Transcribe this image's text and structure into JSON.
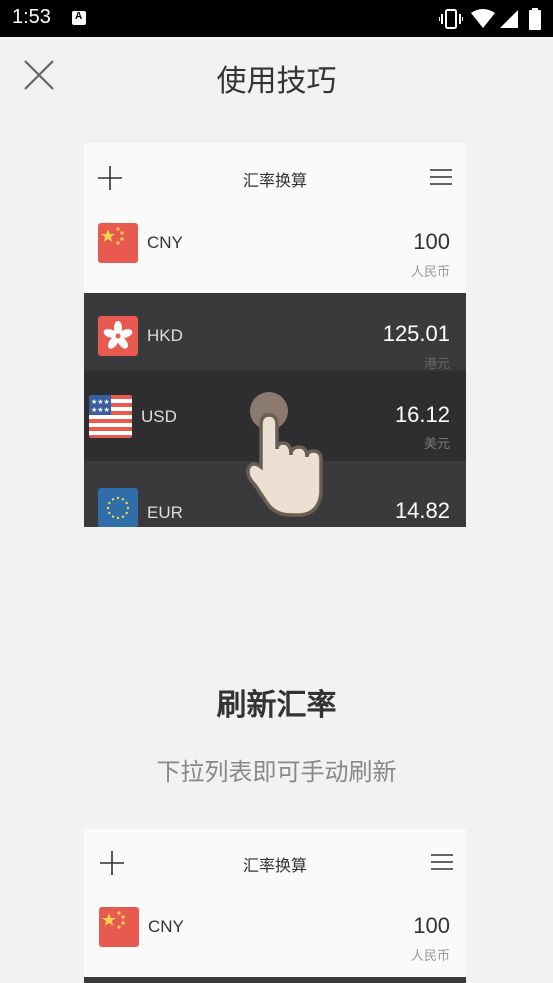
{
  "status_bar": {
    "time": "1:53"
  },
  "page": {
    "title": "使用技巧"
  },
  "demo1": {
    "header_title": "汇率换算",
    "rows": [
      {
        "code": "CNY",
        "amount": "100",
        "name": "人民币"
      },
      {
        "code": "HKD",
        "amount": "125.01",
        "name": "港元"
      },
      {
        "code": "USD",
        "amount": "16.12",
        "name": "美元"
      },
      {
        "code": "EUR",
        "amount": "14.82",
        "name": ""
      }
    ]
  },
  "tip": {
    "title": "刷新汇率",
    "description": "下拉列表即可手动刷新"
  },
  "demo2": {
    "header_title": "汇率换算",
    "rows": [
      {
        "code": "CNY",
        "amount": "100",
        "name": "人民币"
      }
    ]
  }
}
